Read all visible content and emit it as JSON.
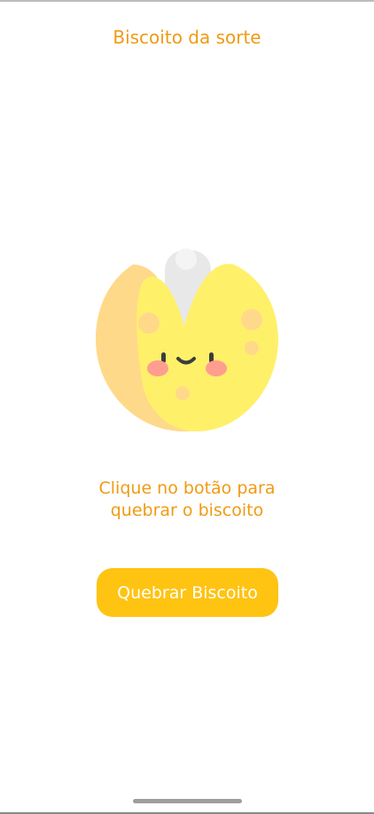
{
  "header": {
    "title": "Biscoito da sorte"
  },
  "cookie": {
    "icon": "fortune-cookie-icon"
  },
  "main": {
    "message": "Clique no botão para\nquebrar o biscoito"
  },
  "actions": {
    "break_button_label": "Quebrar Biscoito"
  },
  "colors": {
    "accent_text": "#f09a12",
    "button_bg": "#ffc312",
    "button_text": "#ffffff",
    "cookie_left": "#ffd98a",
    "cookie_right": "#fff06a",
    "paper": "#e8e8e8",
    "cheek": "#ff9d8f"
  }
}
